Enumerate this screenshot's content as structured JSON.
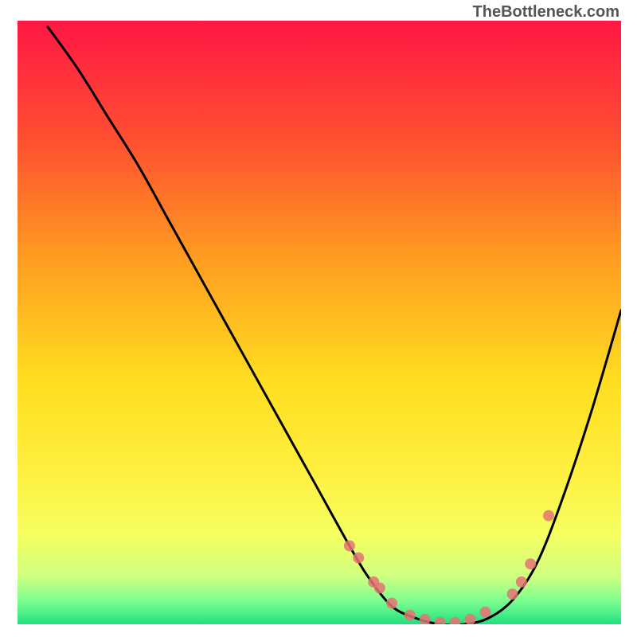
{
  "watermark": "TheBottleneck.com",
  "chart_data": {
    "type": "line",
    "title": "",
    "xlabel": "",
    "ylabel": "",
    "xlim": [
      0,
      100
    ],
    "ylim": [
      0,
      100
    ],
    "background_gradient_stops": [
      {
        "offset": 0,
        "color": "#ff1744"
      },
      {
        "offset": 20,
        "color": "#ff5030"
      },
      {
        "offset": 40,
        "color": "#ff9f20"
      },
      {
        "offset": 60,
        "color": "#ffde20"
      },
      {
        "offset": 75,
        "color": "#fff040"
      },
      {
        "offset": 85,
        "color": "#f5ff60"
      },
      {
        "offset": 92,
        "color": "#d0ff80"
      },
      {
        "offset": 96,
        "color": "#80ff90"
      },
      {
        "offset": 100,
        "color": "#20e080"
      }
    ],
    "series": [
      {
        "name": "bottleneck-curve",
        "x": [
          5,
          10,
          15,
          20,
          25,
          30,
          35,
          40,
          45,
          50,
          55,
          58,
          62,
          66,
          70,
          74,
          78,
          82,
          86,
          90,
          95,
          100
        ],
        "y": [
          99,
          92,
          84,
          76,
          67,
          58,
          49,
          40,
          31,
          22,
          13,
          8,
          3,
          1,
          0,
          0,
          1,
          4,
          10,
          20,
          35,
          52
        ]
      }
    ],
    "markers": {
      "name": "highlight-points",
      "color": "#e57373",
      "radius": 7,
      "x": [
        55.0,
        56.5,
        59.0,
        60.0,
        62.0,
        65.0,
        67.5,
        70.0,
        72.5,
        75.0,
        77.5,
        82.0,
        83.5,
        85.0,
        88.0
      ],
      "y": [
        13.0,
        11.0,
        7.0,
        6.0,
        3.5,
        1.5,
        0.8,
        0.3,
        0.3,
        0.8,
        2.0,
        5.0,
        7.0,
        10.0,
        18.0
      ]
    }
  }
}
